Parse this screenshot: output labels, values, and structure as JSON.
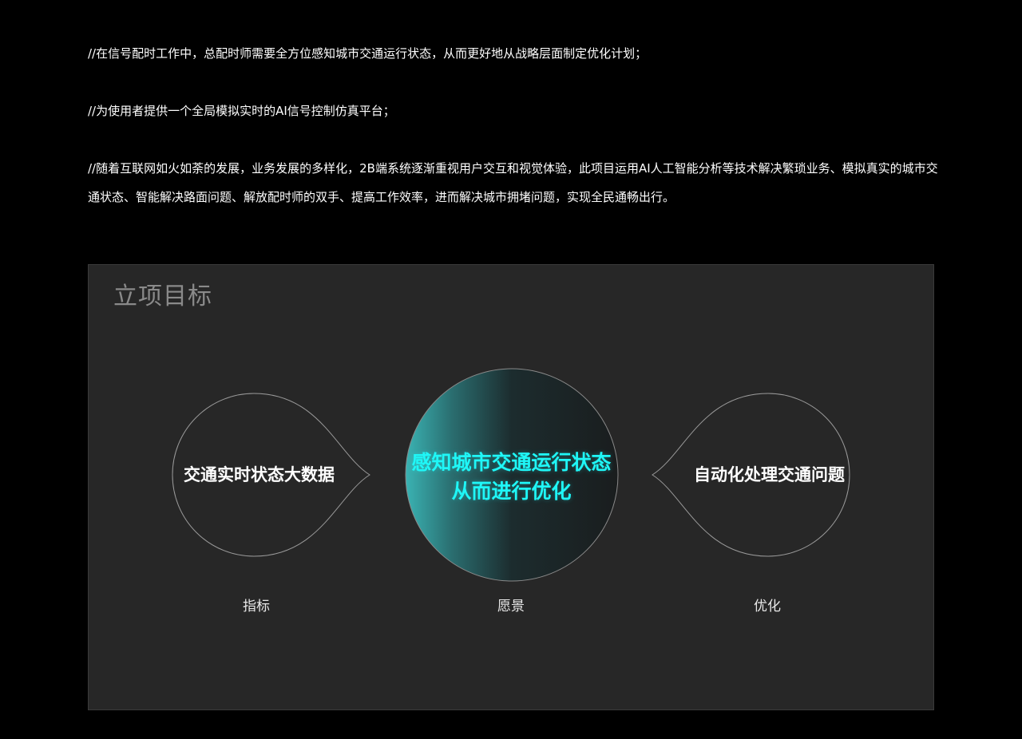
{
  "intro": {
    "paragraph_1": "//在信号配时工作中，总配时师需要全方位感知城市交通运行状态，从而更好地从战略层面制定优化计划；",
    "paragraph_2": "//为使用者提供一个全局模拟实时的AI信号控制仿真平台；",
    "paragraph_3": "//随着互联网如火如荼的发展，业务发展的多样化，2B端系统逐渐重视用户交互和视觉体验，此项目运用AI人工智能分析等技术解决繁琐业务、模拟真实的城市交通状态、智能解决路面问题、解放配时师的双手、提高工作效率，进而解决城市拥堵问题，实现全民通畅出行。"
  },
  "panel": {
    "title": "立项目标",
    "left_bubble": {
      "text": "交通实时状态大数据",
      "caption": "指标"
    },
    "center_bubble": {
      "line_1": "感知城市交通运行状态",
      "line_2": "从而进行优化",
      "caption": "愿景"
    },
    "right_bubble": {
      "text": "自动化处理交通问题",
      "caption": "优化"
    }
  },
  "colors": {
    "background": "#000000",
    "panel": "#272727",
    "accent": "#1ff7f7",
    "gradient_start": "#3ab3b3"
  }
}
